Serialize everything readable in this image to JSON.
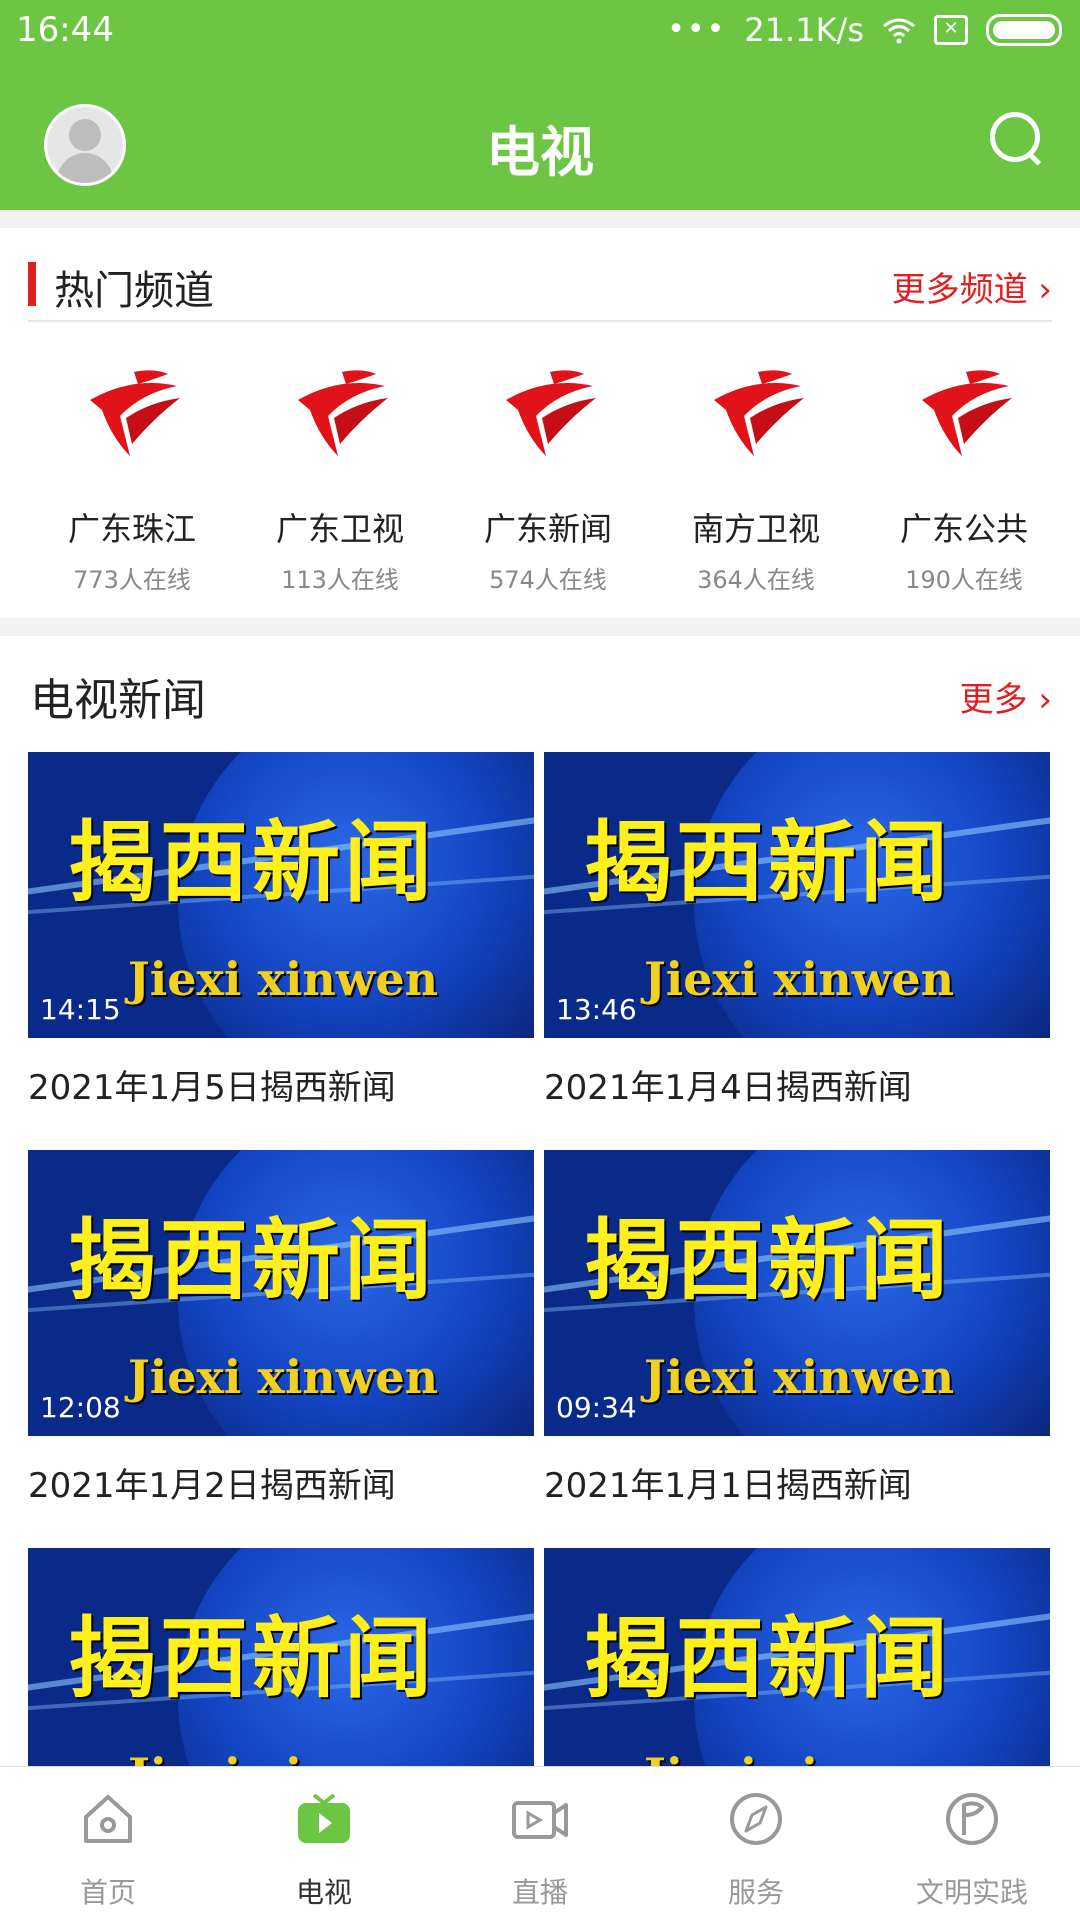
{
  "status_bar": {
    "time": "16:44",
    "dots": "•••",
    "speed": "21.1K/s",
    "sim_icon": "sim-x-icon",
    "battery_icon": "battery-icon",
    "wifi_icon": "wifi-icon"
  },
  "header": {
    "title": "电视",
    "avatar_icon": "avatar-icon",
    "search_icon": "search-icon",
    "bg_color": "#6cc644"
  },
  "hot_channels": {
    "title": "热门频道",
    "more_label": "更多频道 ›",
    "accent_color": "#e02020",
    "items": [
      {
        "name": "广东珠江",
        "online": "773人在线"
      },
      {
        "name": "广东卫视",
        "online": "113人在线"
      },
      {
        "name": "广东新闻",
        "online": "574人在线"
      },
      {
        "name": "南方卫视",
        "online": "364人在线"
      },
      {
        "name": "广东公共",
        "online": "190人在线"
      }
    ]
  },
  "tv_news": {
    "title": "电视新闻",
    "more_label": "更多 ›",
    "thumb_title_cn": "揭西新闻",
    "thumb_title_en": "Jiexi xinwen",
    "items": [
      {
        "duration": "14:15",
        "caption": "2021年1月5日揭西新闻"
      },
      {
        "duration": "13:46",
        "caption": "2021年1月4日揭西新闻"
      },
      {
        "duration": "12:08",
        "caption": "2021年1月2日揭西新闻"
      },
      {
        "duration": "09:34",
        "caption": "2021年1月1日揭西新闻"
      },
      {
        "duration": "",
        "caption": ""
      },
      {
        "duration": "",
        "caption": ""
      }
    ]
  },
  "tabbar": {
    "active_color": "#6cc644",
    "items": [
      {
        "label": "首页",
        "icon": "home-icon"
      },
      {
        "label": "电视",
        "icon": "tv-icon"
      },
      {
        "label": "直播",
        "icon": "live-camera-icon"
      },
      {
        "label": "服务",
        "icon": "compass-icon"
      },
      {
        "label": "文明实践",
        "icon": "flag-circle-icon"
      }
    ]
  }
}
